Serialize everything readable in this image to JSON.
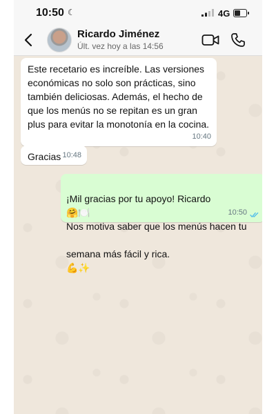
{
  "status_bar": {
    "time": "10:50",
    "network": "4G"
  },
  "header": {
    "contact_name": "Ricardo Jiménez",
    "last_seen": "Últ. vez hoy a las 14:56"
  },
  "messages": [
    {
      "direction": "in",
      "text": "Este recetario es increíble. Las versiones\neconómicas no solo son prácticas, sino\ntambién deliciosas. Además, el hecho de\nque los menús no se repitan es un gran\nplus para evitar la monotonía en la cocina.",
      "time": "10:40"
    },
    {
      "direction": "in",
      "text": "Gracias",
      "time": "10:48"
    },
    {
      "direction": "out",
      "line1": "¡Mil gracias por tu apoyo! Ricardo",
      "line1_emojis": "🤗🍽️",
      "line2": "Nos motiva saber que los menús hacen tu",
      "line3": "semana más fácil y rica.",
      "line3_emojis": "💪✨",
      "time": "10:50",
      "read": true
    }
  ],
  "colors": {
    "incoming_bubble": "#ffffff",
    "outgoing_bubble": "#d9fdd3",
    "read_ticks": "#53bdeb",
    "chat_background": "#efe7dc"
  },
  "icons": [
    "moon-icon",
    "signal-icon",
    "battery-icon",
    "back-icon",
    "video-call-icon",
    "phone-call-icon",
    "double-check-icon"
  ]
}
